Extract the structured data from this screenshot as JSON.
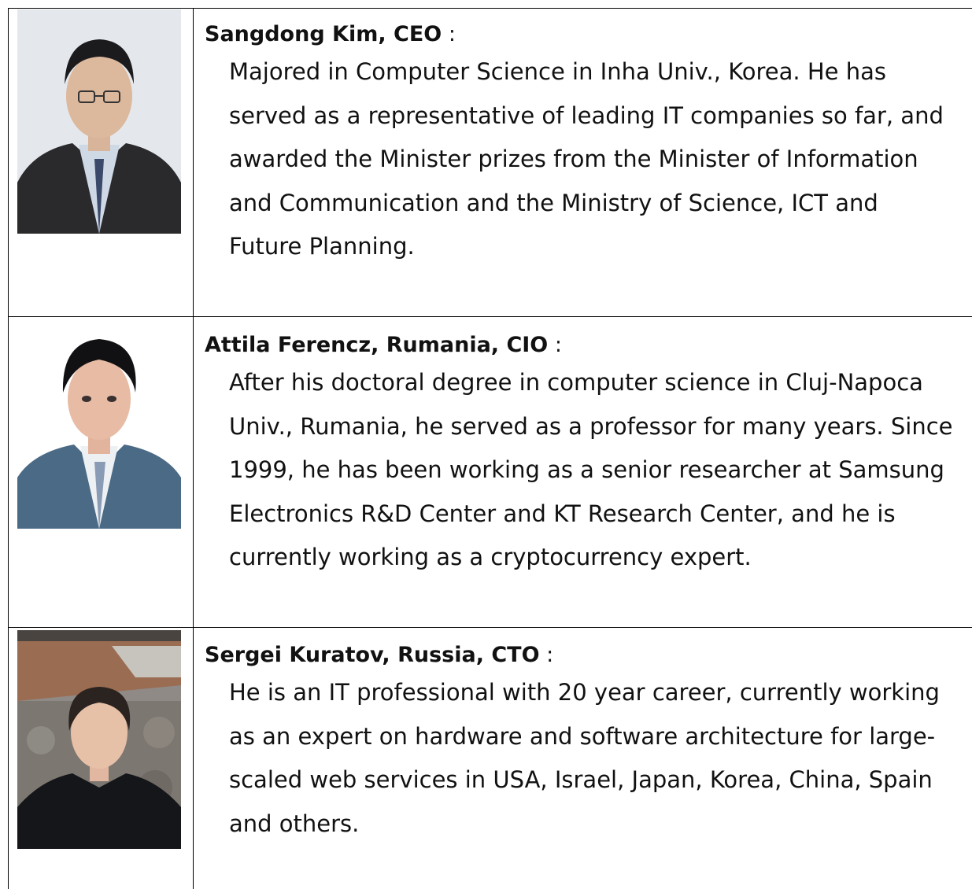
{
  "people": [
    {
      "name": "Sangdong Kim, CEO",
      "separator": ":",
      "bio_lines": [
        "Majored in Computer Science in Inha Univ., Korea. He has",
        "served as a representative of leading IT companies so far, and",
        "awarded the Minister prizes from the Minister of Information",
        "and Communication and the Ministry of Science, ICT and",
        "Future Planning."
      ]
    },
    {
      "name": "Attila Ferencz, Rumania, CIO",
      "separator": ":",
      "bio_lines": [
        "After his doctoral degree in computer science in Cluj-Napoca",
        "Univ., Rumania, he served as a professor for many years. Since",
        "1999, he has been working as a senior researcher at Samsung",
        "Electronics R&D Center and KT Research Center, and he is",
        "currently working as a cryptocurrency expert."
      ]
    },
    {
      "name": "Sergei Kuratov, Russia, CTO",
      "separator": ":",
      "bio_lines": [
        "He is an IT professional with 20 year career, currently working",
        "as an expert on hardware and software architecture for large-",
        "scaled web services in USA, Israel, Japan, Korea, China, Spain",
        "and others."
      ]
    }
  ]
}
